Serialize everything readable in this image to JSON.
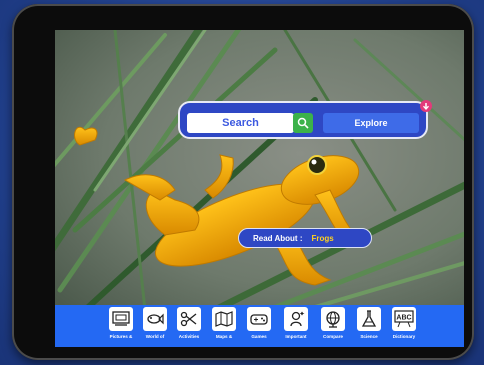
{
  "search": {
    "placeholder": "Search",
    "explore_label": "Explore"
  },
  "read_about": {
    "label": "Read About :",
    "topic": "Frogs"
  },
  "toolbar": {
    "items": [
      {
        "label": "Pictures &",
        "icon": "pictures-icon"
      },
      {
        "label": "World of",
        "icon": "fish-icon"
      },
      {
        "label": "Activities",
        "icon": "scissors-icon"
      },
      {
        "label": "Maps &",
        "icon": "map-icon"
      },
      {
        "label": "Games",
        "icon": "gamepad-icon"
      },
      {
        "label": "Important",
        "icon": "astronaut-icon"
      },
      {
        "label": "Compare",
        "icon": "globe-icon"
      },
      {
        "label": "Science",
        "icon": "flask-icon"
      },
      {
        "label": "Dictionary",
        "icon": "dictionary-icon"
      }
    ]
  },
  "colors": {
    "brand_blue": "#2e47c4",
    "toolbar_blue": "#2469f3",
    "search_green": "#3cb24a",
    "topic_yellow": "#ffd21f"
  }
}
